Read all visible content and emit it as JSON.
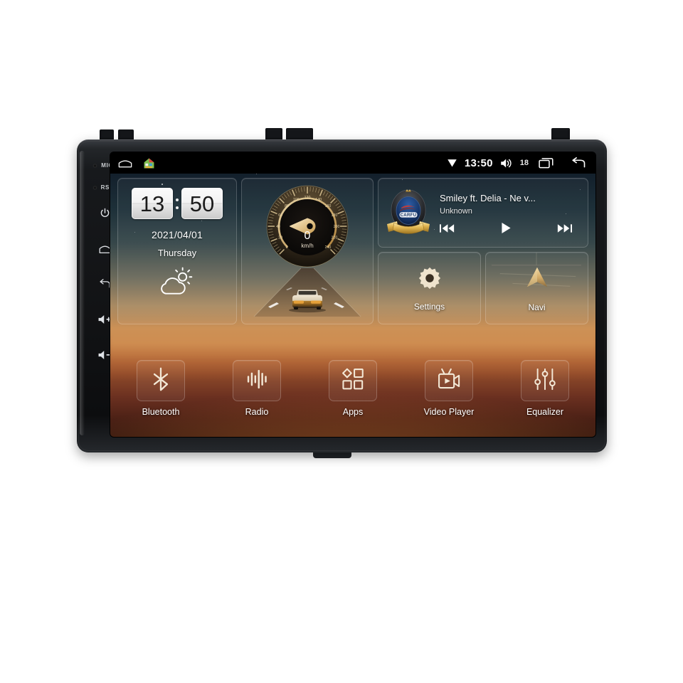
{
  "device": {
    "side_buttons": [
      {
        "name": "mic",
        "label": "MIC"
      },
      {
        "name": "reset",
        "label": "RST"
      },
      {
        "name": "power",
        "label": "power-icon"
      },
      {
        "name": "home",
        "label": "home-icon"
      },
      {
        "name": "back",
        "label": "back-icon"
      },
      {
        "name": "volume-up",
        "label": "volume-up-icon"
      },
      {
        "name": "volume-down",
        "label": "volume-down-icon"
      }
    ]
  },
  "statusbar": {
    "home_icon": "home-outline-icon",
    "app_icon": "house-app-icon",
    "signal_icon": "wifi-signal-icon",
    "time": "13:50",
    "volume_icon": "volume-icon",
    "volume_level": "18",
    "recents_icon": "recents-icon",
    "back_icon": "back-arrow-icon"
  },
  "clock_widget": {
    "hours": "13",
    "minutes": "50",
    "date": "2021/04/01",
    "weekday": "Thursday",
    "weather_icon": "partly-cloudy-icon"
  },
  "speedometer": {
    "value": "0",
    "unit": "km/h",
    "ticks": [
      "0",
      "20",
      "40",
      "60",
      "80",
      "100",
      "120",
      "140",
      "160",
      "180",
      "200",
      "220",
      "240"
    ],
    "min": 0,
    "max": 240
  },
  "music": {
    "title": "Smiley ft. Delia - Ne v...",
    "artist": "Unknown",
    "album_art_brand": "CARFU",
    "prev_icon": "skip-previous-icon",
    "play_icon": "play-icon",
    "next_icon": "skip-next-icon"
  },
  "tiles": [
    {
      "label": "Settings",
      "icon": "gear-icon",
      "name": "settings"
    },
    {
      "label": "Navi",
      "icon": "navigation-arrow-icon",
      "name": "navi"
    }
  ],
  "dock": [
    {
      "label": "Bluetooth",
      "icon": "bluetooth-icon",
      "name": "bluetooth"
    },
    {
      "label": "Radio",
      "icon": "radio-waveform-icon",
      "name": "radio"
    },
    {
      "label": "Apps",
      "icon": "apps-grid-icon",
      "name": "apps"
    },
    {
      "label": "Video Player",
      "icon": "video-camera-icon",
      "name": "video-player"
    },
    {
      "label": "Equalizer",
      "icon": "equalizer-sliders-icon",
      "name": "equalizer"
    }
  ],
  "colors": {
    "accent_gold": "#d9b271",
    "sky_top": "#0b1420",
    "sunset": "#b06d3c",
    "bezel": "#17191c",
    "status_bar": "#000000"
  }
}
